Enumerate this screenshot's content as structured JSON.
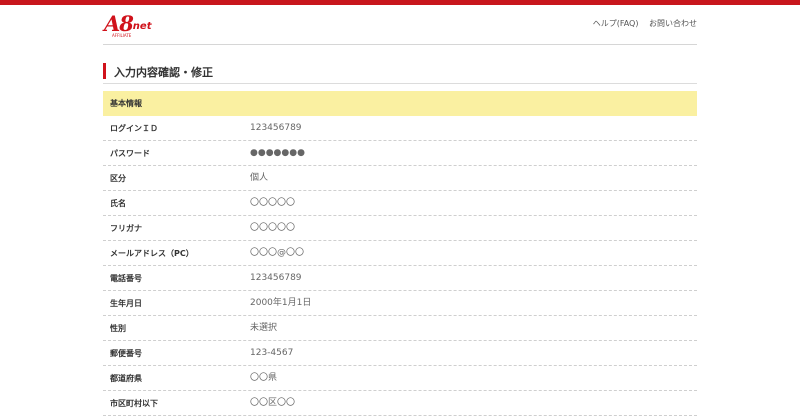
{
  "header": {
    "logo": {
      "main": "A8",
      "suffix": ".net",
      "tagline": "AFFILIATE"
    },
    "links": [
      "ヘルプ(FAQ)",
      "お問い合わせ"
    ]
  },
  "page_title": "入力内容確認・修正",
  "section_title": "基本情報",
  "rows": [
    {
      "label": "ログインＩＤ",
      "value": "123456789"
    },
    {
      "label": "パスワード",
      "value": "●●●●●●●"
    },
    {
      "label": "区分",
      "value": "個人"
    },
    {
      "label": "氏名",
      "value": "〇〇〇〇〇"
    },
    {
      "label": "フリガナ",
      "value": "〇〇〇〇〇"
    },
    {
      "label": "メールアドレス（PC）",
      "value": "〇〇〇@〇〇"
    },
    {
      "label": "電話番号",
      "value": "123456789"
    },
    {
      "label": "生年月日",
      "value": "2000年1月1日"
    },
    {
      "label": "性別",
      "value": "未選択"
    },
    {
      "label": "郵便番号",
      "value": "123-4567"
    },
    {
      "label": "都道府県",
      "value": "〇〇県"
    },
    {
      "label": "市区町村以下",
      "value": "〇〇区〇〇"
    }
  ]
}
